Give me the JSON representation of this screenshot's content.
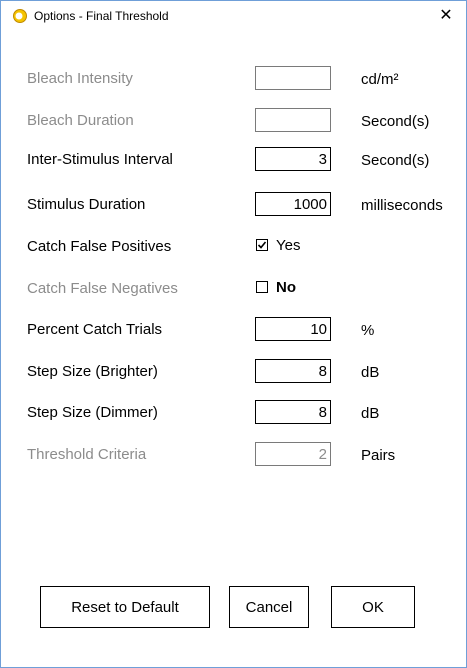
{
  "window": {
    "title": "Options - Final Threshold",
    "close_label": "✕"
  },
  "fields": [
    {
      "label": "Bleach Intensity",
      "value": "",
      "unit": "cd/m²",
      "enabled": false
    },
    {
      "label": "Bleach Duration",
      "value": "",
      "unit": "Second(s)",
      "enabled": false
    },
    {
      "label": "Inter-Stimulus Interval",
      "value": "3",
      "unit": "Second(s)",
      "enabled": true
    },
    {
      "label": "Stimulus Duration",
      "value": "1000",
      "unit": "milliseconds",
      "enabled": true
    }
  ],
  "catch_false_positives": {
    "label": "Catch False Positives",
    "checkbox_label": "Yes",
    "checked": true,
    "enabled": true
  },
  "catch_false_negatives": {
    "label": "Catch False Negatives",
    "checkbox_label": "No",
    "checked": false,
    "enabled": false
  },
  "fields2": [
    {
      "label": "Percent Catch Trials",
      "value": "10",
      "unit": "%",
      "enabled": true
    },
    {
      "label": "Step Size (Brighter)",
      "value": "8",
      "unit": "dB",
      "enabled": true
    },
    {
      "label": "Step Size (Dimmer)",
      "value": "8",
      "unit": "dB",
      "enabled": true
    },
    {
      "label": "Threshold Criteria",
      "value": "2",
      "unit": "Pairs",
      "enabled": false
    }
  ],
  "buttons": {
    "reset": "Reset to Default",
    "cancel": "Cancel",
    "ok": "OK"
  },
  "colors": {
    "disabled_text": "#8c8c8c",
    "window_border": "#6f9fd8",
    "icon_yellow": "#f5c400"
  },
  "icons": {
    "title": "app-sun-icon",
    "close": "close-icon",
    "check": "checkmark-icon"
  }
}
